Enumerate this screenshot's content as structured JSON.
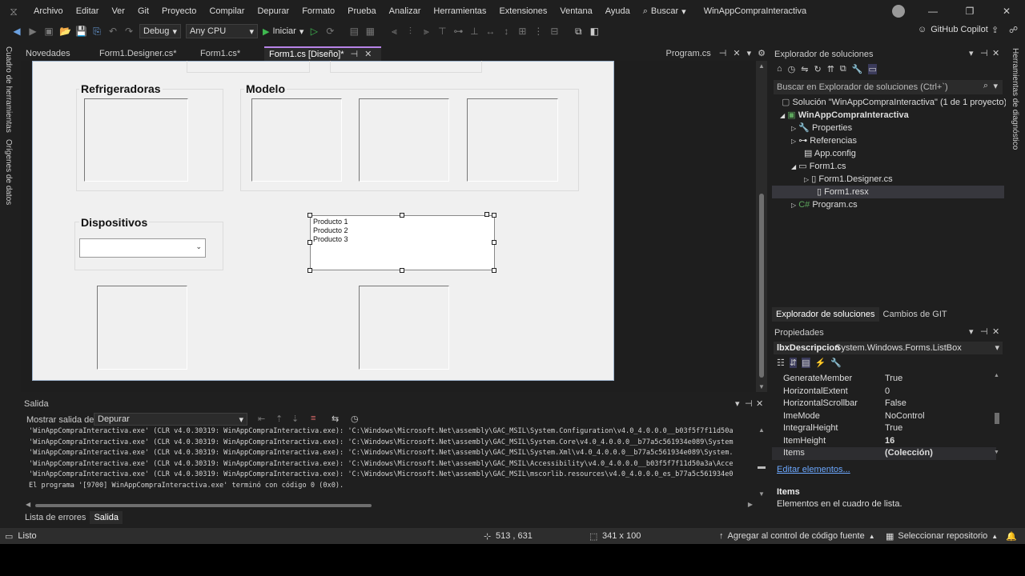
{
  "menubar": {
    "items": [
      "Archivo",
      "Editar",
      "Ver",
      "Git",
      "Proyecto",
      "Compilar",
      "Depurar",
      "Formato",
      "Prueba",
      "Analizar",
      "Herramientas",
      "Extensiones",
      "Ventana",
      "Ayuda"
    ],
    "search_label": "Buscar",
    "window_title": "WinAppCompraInteractiva"
  },
  "toolbar": {
    "config": "Debug",
    "platform": "Any CPU",
    "start_label": "Iniciar",
    "copilot_label": "GitHub Copilot"
  },
  "left_strip": {
    "toolbox": "Cuadro de herramientas",
    "datasources": "Orígenes de datos"
  },
  "right_strip": {
    "diagnostics": "Herramientas de diagnóstico"
  },
  "doc_tabs": [
    "Novedades",
    "Form1.Designer.cs*",
    "Form1.cs*",
    "Form1.cs [Diseño]*"
  ],
  "doc_tab_right": "Program.cs",
  "form": {
    "group_refrigeradoras": "Refrigeradoras",
    "group_modelo": "Modelo",
    "group_dispositivos": "Dispositivos",
    "listbox_items": [
      "Producto 1",
      "Producto 2",
      "Producto 3"
    ]
  },
  "output": {
    "title": "Salida",
    "show_from_label": "Mostrar salida de:",
    "show_from_value": "Depurar",
    "lines": [
      "'WinAppCompraInteractiva.exe' (CLR v4.0.30319: WinAppCompraInteractiva.exe): 'C:\\Windows\\Microsoft.Net\\assembly\\GAC_MSIL\\System.Configuration\\v4.0_4.0.0.0__b03f5f7f11d50a",
      "'WinAppCompraInteractiva.exe' (CLR v4.0.30319: WinAppCompraInteractiva.exe): 'C:\\Windows\\Microsoft.Net\\assembly\\GAC_MSIL\\System.Core\\v4.0_4.0.0.0__b77a5c561934e089\\System",
      "'WinAppCompraInteractiva.exe' (CLR v4.0.30319: WinAppCompraInteractiva.exe): 'C:\\Windows\\Microsoft.Net\\assembly\\GAC_MSIL\\System.Xml\\v4.0_4.0.0.0__b77a5c561934e089\\System.",
      "'WinAppCompraInteractiva.exe' (CLR v4.0.30319: WinAppCompraInteractiva.exe): 'C:\\Windows\\Microsoft.Net\\assembly\\GAC_MSIL\\Accessibility\\v4.0_4.0.0.0__b03f5f7f11d50a3a\\Acce",
      "'WinAppCompraInteractiva.exe' (CLR v4.0.30319: WinAppCompraInteractiva.exe): 'C:\\Windows\\Microsoft.Net\\assembly\\GAC_MSIL\\mscorlib.resources\\v4.0_4.0.0.0_es_b77a5c561934e0",
      "El programa '[9700] WinAppCompraInteractiva.exe' terminó con código 0 (0x0)."
    ],
    "tabs": [
      "Lista de errores",
      "Salida"
    ]
  },
  "solution_explorer": {
    "title": "Explorador de soluciones",
    "search_placeholder": "Buscar en Explorador de soluciones (Ctrl+`)",
    "tree": [
      {
        "label": "Solución \"WinAppCompraInteractiva\"  (1 de 1 proyecto)"
      },
      {
        "label": "WinAppCompraInteractiva"
      },
      {
        "label": "Properties"
      },
      {
        "label": "Referencias"
      },
      {
        "label": "App.config"
      },
      {
        "label": "Form1.cs"
      },
      {
        "label": "Form1.Designer.cs"
      },
      {
        "label": "Form1.resx"
      },
      {
        "label": "Program.cs"
      }
    ],
    "bottom_tabs": [
      "Explorador de soluciones",
      "Cambios de GIT"
    ]
  },
  "properties": {
    "title": "Propiedades",
    "object_name": "lbxDescripcion",
    "object_type": "System.Windows.Forms.ListBox",
    "rows": [
      {
        "name": "GenerateMember",
        "value": "True"
      },
      {
        "name": "HorizontalExtent",
        "value": "0"
      },
      {
        "name": "HorizontalScrollbar",
        "value": "False"
      },
      {
        "name": "ImeMode",
        "value": "NoControl"
      },
      {
        "name": "IntegralHeight",
        "value": "True"
      },
      {
        "name": "ItemHeight",
        "value": "16"
      },
      {
        "name": "Items",
        "value": "(Colección)"
      }
    ],
    "link": "Editar elementos...",
    "desc_title": "Items",
    "desc_text": "Elementos en el cuadro de lista."
  },
  "status": {
    "ready": "Listo",
    "position": "513 , 631",
    "size": "341 x 100",
    "source_control": "Agregar al control de código fuente",
    "repo": "Seleccionar repositorio"
  }
}
